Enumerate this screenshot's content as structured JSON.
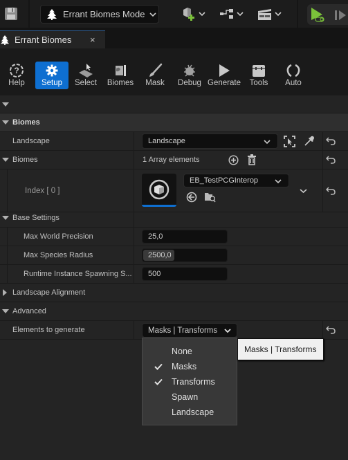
{
  "top_toolbar": {
    "mode_dropdown_label": "Errant Biomes Mode",
    "save_icon": "save-icon",
    "add_actor_icon": "add-actor-icon",
    "blueprint_icon": "blueprint-icon",
    "cinematics_icon": "clapperboard-icon",
    "play_icon": "play-icon",
    "skip_icon": "advance-frame-icon"
  },
  "tab": {
    "label": "Errant Biomes",
    "close": "×"
  },
  "mode_buttons": [
    {
      "label": "Help",
      "icon": "help-icon",
      "active": false
    },
    {
      "label": "Setup",
      "icon": "gear-icon",
      "active": true
    },
    {
      "label": "Select",
      "icon": "select-icon",
      "active": false
    },
    {
      "label": "Biomes",
      "icon": "biomes-icon",
      "active": false
    },
    {
      "label": "Mask",
      "icon": "brush-icon",
      "active": false
    },
    {
      "label": "Debug",
      "icon": "bug-icon",
      "active": false
    },
    {
      "label": "Generate",
      "icon": "play-icon",
      "active": false
    },
    {
      "label": "Tools",
      "icon": "toolbox-icon",
      "active": false
    },
    {
      "label": "Auto",
      "icon": "refresh-icon",
      "active": false
    }
  ],
  "details": {
    "category_biomes": "Biomes",
    "landscape_label": "Landscape",
    "landscape_value": "Landscape",
    "biomes_array_label": "Biomes",
    "biomes_array_count": "1 Array elements",
    "index_label": "Index [ 0 ]",
    "index_asset": "EB_TestPCGInterop",
    "base_settings": "Base Settings",
    "max_world_precision_label": "Max World Precision",
    "max_world_precision_value": "25,0",
    "max_species_radius_label": "Max Species Radius",
    "max_species_radius_value": "2500,0",
    "runtime_spawning_label": "Runtime Instance Spawning S...",
    "runtime_spawning_value": "500",
    "landscape_alignment": "Landscape Alignment",
    "advanced": "Advanced",
    "elements_label": "Elements to generate",
    "elements_value": "Masks | Transforms"
  },
  "elements_menu": {
    "items": [
      {
        "label": "None",
        "checked": false
      },
      {
        "label": "Masks",
        "checked": true
      },
      {
        "label": "Transforms",
        "checked": true
      },
      {
        "label": "Spawn",
        "checked": false
      },
      {
        "label": "Landscape",
        "checked": false
      }
    ]
  },
  "tooltip": "Masks | Transforms",
  "colors": {
    "accent": "#0e6fd1",
    "play_green": "#7bc23a",
    "panel_bg": "#242424",
    "category_bg": "#2f2f2f"
  }
}
